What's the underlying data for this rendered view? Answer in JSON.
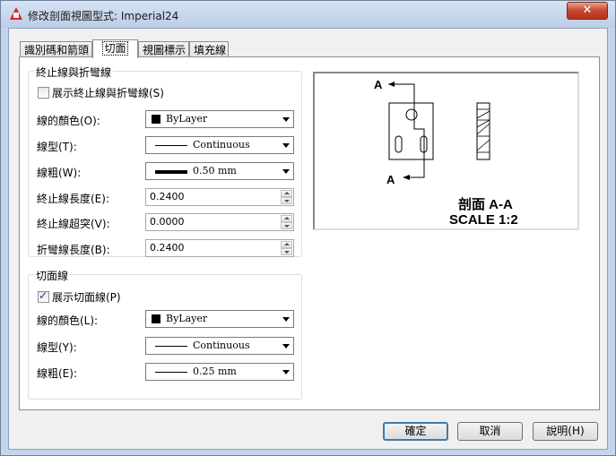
{
  "window": {
    "title": "修改剖面視圖型式: Imperial24",
    "close_label": "✕"
  },
  "tabs": [
    {
      "label": "識別碼和箭頭"
    },
    {
      "label": "切面"
    },
    {
      "label": "視圖標示"
    },
    {
      "label": "填充線"
    }
  ],
  "break_lines": {
    "group_title": "終止線與折彎線",
    "show_label": "展示終止線與折彎線(S)",
    "show_checked": false,
    "color_label": "線的顏色(O):",
    "color_value": "ByLayer",
    "linetype_label": "線型(T):",
    "linetype_value": "Continuous",
    "lineweight_label": "線粗(W):",
    "lineweight_value": "0.50 mm",
    "end_length_label": "終止線長度(E):",
    "end_length_value": "0.2400",
    "end_overshoot_label": "終止線超突(V):",
    "end_overshoot_value": "0.0000",
    "bend_length_label": "折彎線長度(B):",
    "bend_length_value": "0.2400"
  },
  "cutting_plane": {
    "group_title": "切面線",
    "show_label": "展示切面線(P)",
    "show_checked": true,
    "color_label": "線的顏色(L):",
    "color_value": "ByLayer",
    "linetype_label": "線型(Y):",
    "linetype_value": "Continuous",
    "lineweight_label": "線粗(E):",
    "lineweight_value": "0.25 mm"
  },
  "preview": {
    "label_top": "A",
    "label_bottom": "A",
    "caption_line1": "剖面 A-A",
    "caption_line2": "SCALE 1:2"
  },
  "buttons": {
    "ok": "確定",
    "cancel": "取消",
    "help": "說明(H)"
  }
}
